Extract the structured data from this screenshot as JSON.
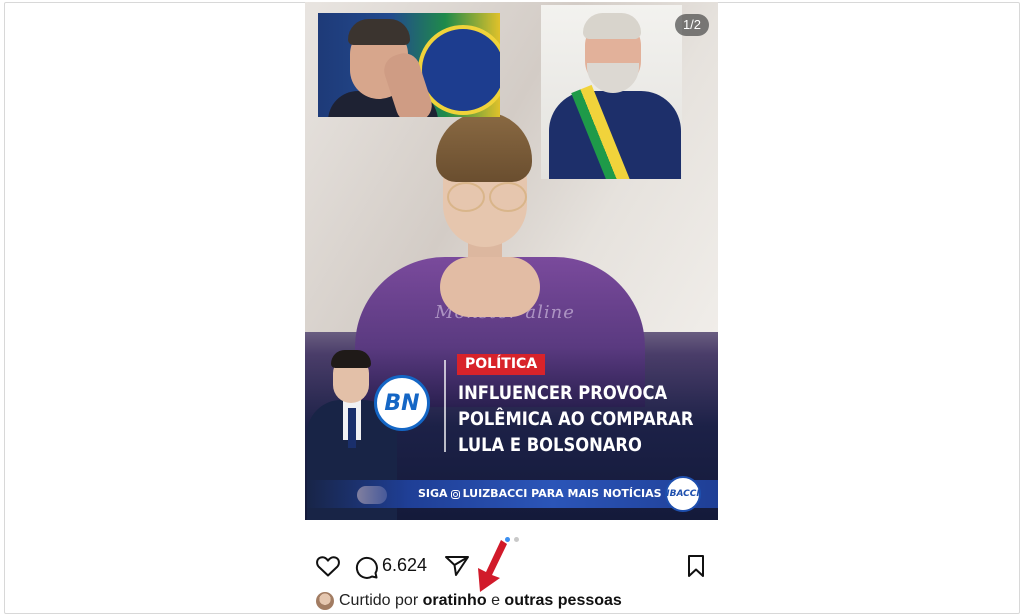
{
  "post": {
    "page_indicator": "1/2",
    "category_tag": "POLÍTICA",
    "headline_lines": [
      "INFLUENCER PROVOCA",
      "POLÊMICA AO COMPARAR",
      "LULA E BOLSONARO"
    ],
    "banner_prefix": "SIGA",
    "banner_handle_text": "LUIZBACCI PARA MAIS NOTÍCIAS",
    "logo_main": "BN",
    "logo_small": "IBACCI",
    "shirt_text": "Monster aline",
    "carousel": {
      "total": 2,
      "active": 1
    }
  },
  "actions": {
    "comment_count": "6.624",
    "icons": [
      "heart-icon",
      "comment-icon",
      "send-icon",
      "bookmark-icon"
    ]
  },
  "likes": {
    "prefix": "Curtido por",
    "user": "oratinho",
    "connector": "e",
    "others": "outras pessoas"
  },
  "colors": {
    "category_red": "#d8232a",
    "banner_blue": "#2b55b8",
    "carousel_active": "#3b8ff0",
    "arrow_red": "#d11a2a"
  }
}
